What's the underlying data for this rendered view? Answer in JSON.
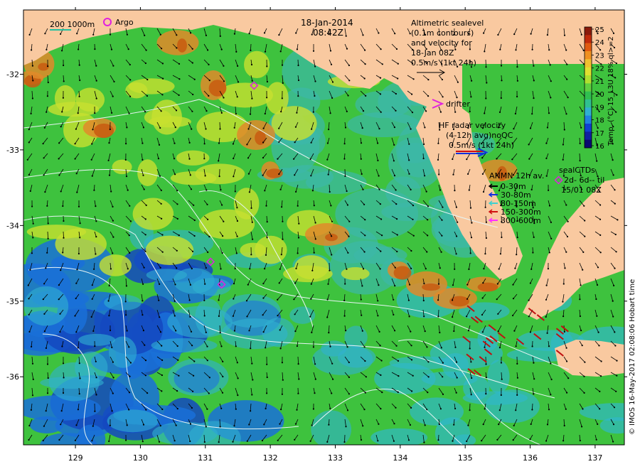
{
  "title": {
    "date": "18-Jan-2014",
    "time": "08:42Z"
  },
  "scale_bar": {
    "text": "200  1000m"
  },
  "legend": {
    "argo": "Argo",
    "altimetry": [
      "Altimetric sealevel",
      "(0.1m contours)",
      "and velocity for",
      "18-Jan 08Z",
      "0.5m/s (1kt 24h)"
    ],
    "drifter": "drifter",
    "hf_radar": [
      "HF radar velocity",
      "(4-12h avg)noQC",
      "0.5m/s (1kt 24h)"
    ],
    "anmn_title": "ANMN 12h av.",
    "anmn_items": [
      {
        "label": "0-30m",
        "color": "#000000"
      },
      {
        "label": "30-80m",
        "color": "#1030e0"
      },
      {
        "label": "80-150m",
        "color": "#40d0d0"
      },
      {
        "label": "150-300m",
        "color": "#d01010"
      },
      {
        "label": "300-600m",
        "color": "#ff30ff"
      }
    ],
    "seal_ctds": [
      "sealCTDs",
      "2d- 6d-- til",
      "15/01 08Z"
    ]
  },
  "colorbar": {
    "label": "Temp. (°C) 15_L3U 18% ql>=2",
    "ticks": [
      "25",
      "24",
      "23",
      "22",
      "21",
      "20",
      "19",
      "18",
      "17",
      "16"
    ]
  },
  "credit": "© IMOS 16-May-2017 02:08:06 Hobart time",
  "axes": {
    "x_ticks": [
      "129",
      "130",
      "131",
      "132",
      "133",
      "134",
      "135",
      "136",
      "137"
    ],
    "y_ticks": [
      "-32",
      "-33",
      "-34",
      "-35",
      "-36"
    ],
    "x_range": [
      128.2,
      137.45
    ],
    "y_range": [
      -36.9,
      -31.15
    ]
  },
  "colors": {
    "land": "#f9c9a0",
    "warm": "#d86a1c",
    "mid": "#3ec23e",
    "cool": "#1a70d8",
    "contour": "#e8f4f4"
  },
  "argo_floats": [
    {
      "lon": 131.75,
      "lat": -32.15
    },
    {
      "lon": 131.08,
      "lat": -34.48
    },
    {
      "lon": 131.25,
      "lat": -34.78
    }
  ]
}
